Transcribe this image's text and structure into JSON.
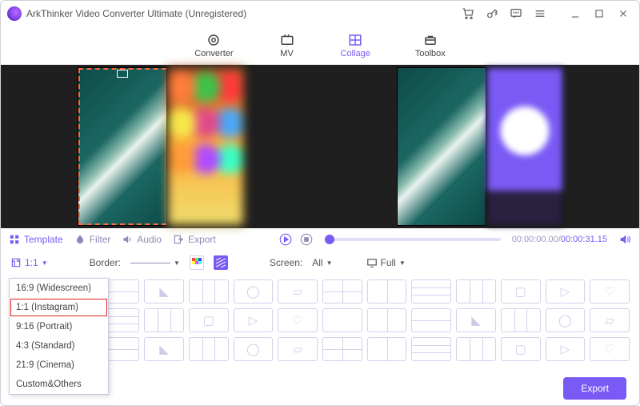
{
  "titlebar": {
    "title": "ArkThinker Video Converter Ultimate (Unregistered)"
  },
  "maintabs": {
    "converter": "Converter",
    "mv": "MV",
    "collage": "Collage",
    "toolbox": "Toolbox",
    "active": "collage"
  },
  "toolrow": {
    "template": "Template",
    "filter": "Filter",
    "audio": "Audio",
    "export": "Export",
    "time_current": "00:00:00.00",
    "time_total": "00:00:31.15"
  },
  "optrow": {
    "ratio_value": "1:1",
    "border_label": "Border:",
    "screen_label": "Screen:",
    "screen_value": "All",
    "view_value": "Full"
  },
  "ratio_menu": {
    "items": [
      "16:9 (Widescreen)",
      "1:1 (Instagram)",
      "9:16 (Portrait)",
      "4:3 (Standard)",
      "21:9 (Cinema)",
      "Custom&Others"
    ],
    "selected_index": 1
  },
  "footer": {
    "export": "Export"
  }
}
